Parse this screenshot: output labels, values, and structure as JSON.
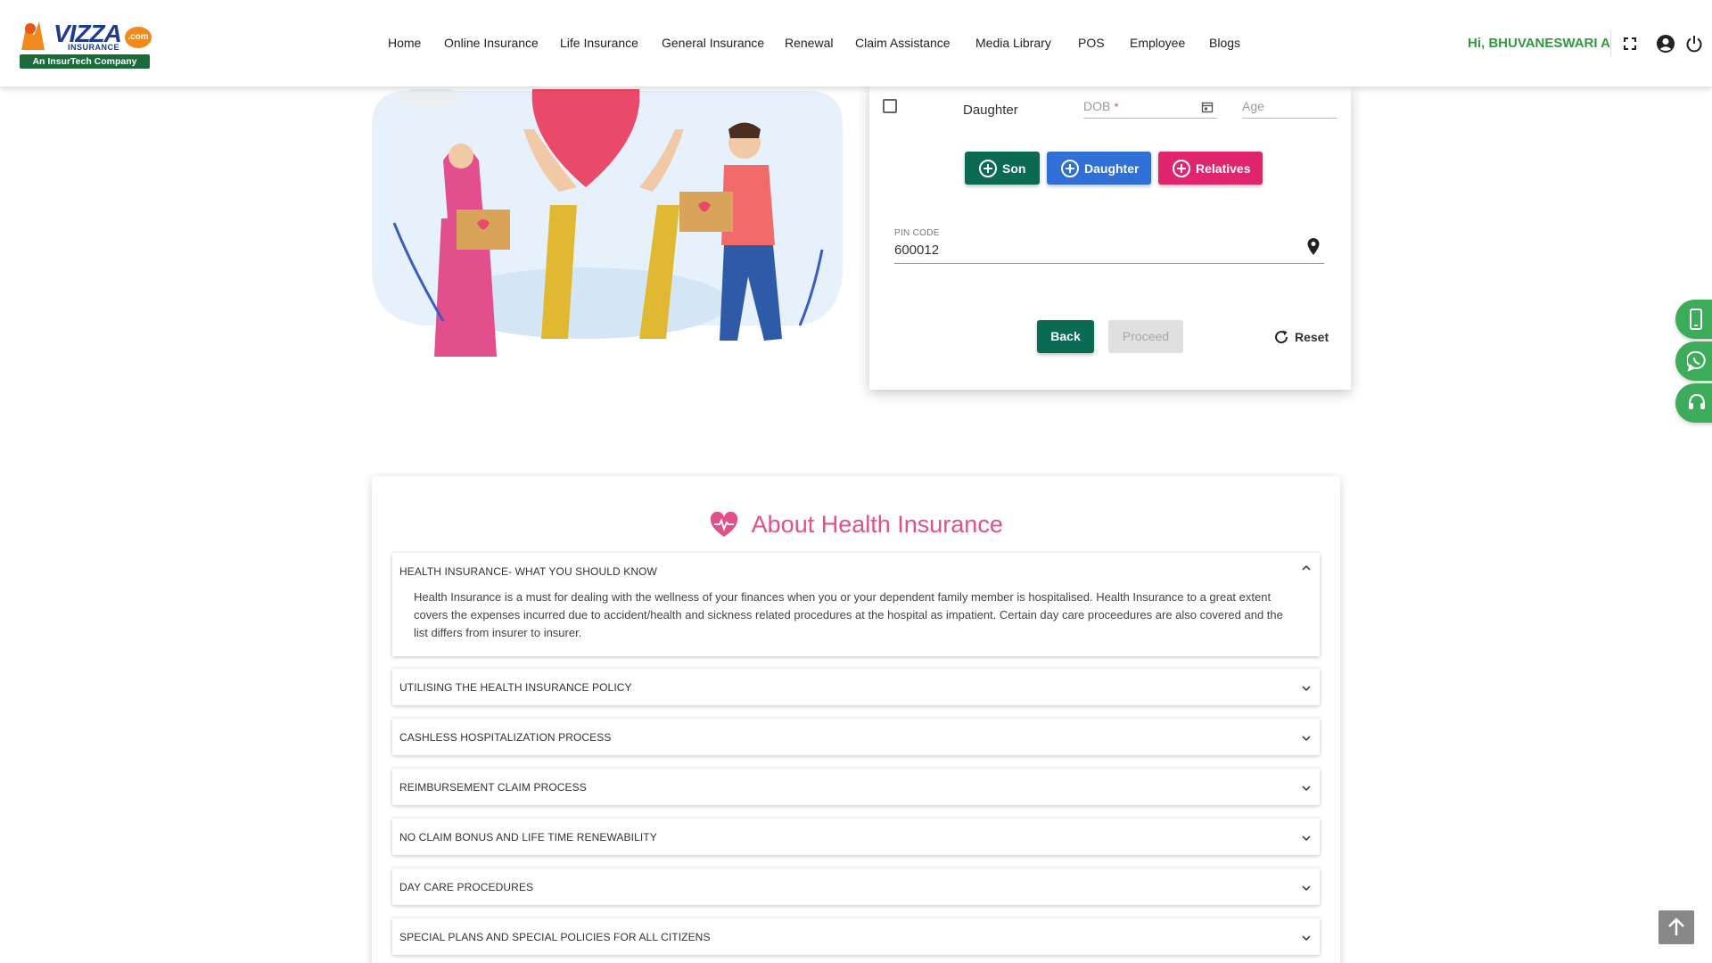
{
  "header": {
    "logo": {
      "brand": "VIZZA",
      "dotcom": ".com",
      "insurance": "INSURANCE",
      "tagline": "An InsurTech Company"
    },
    "nav": [
      {
        "label": "Home"
      },
      {
        "label": "Online Insurance"
      },
      {
        "label": "Life Insurance"
      },
      {
        "label": "General Insurance"
      },
      {
        "label": "Renewal"
      },
      {
        "label": "Claim Assistance"
      },
      {
        "label": "Media Library"
      },
      {
        "label": "POS"
      },
      {
        "label": "Employee"
      },
      {
        "label": "Blogs"
      }
    ],
    "greeting": "Hi, BHUVANESWARI A",
    "icons": [
      "fullscreen-icon",
      "account-icon",
      "power-icon"
    ]
  },
  "form": {
    "member_label": "Daughter",
    "dob_placeholder": "DOB",
    "dob_required": "*",
    "age_placeholder": "Age",
    "add_buttons": [
      {
        "label": "Son",
        "color": "#0b6b52"
      },
      {
        "label": "Daughter",
        "color": "#2f6fd6"
      },
      {
        "label": "Relatives",
        "color": "#e0246e"
      }
    ],
    "pin_label": "PIN CODE",
    "pin_value": "600012",
    "back_label": "Back",
    "proceed_label": "Proceed",
    "reset_label": "Reset"
  },
  "side_buttons": [
    "mobile-icon",
    "whatsapp-icon",
    "support-icon"
  ],
  "about": {
    "title": "About Health Insurance",
    "items": [
      {
        "heading": "HEALTH INSURANCE- WHAT YOU SHOULD KNOW",
        "expanded": true,
        "body": "Health Insurance is a must for dealing with the wellness of your finances when you or your dependent family member is hospitalised. Health Insurance to a great extent covers the expenses incurred due to accident/health and sickness related procedures at the hospital as impatient. Certain day care proceedures are also covered and the list differs from insurer to insurer."
      },
      {
        "heading": "UTILISING THE HEALTH INSURANCE POLICY",
        "expanded": false
      },
      {
        "heading": "CASHLESS HOSPITALIZATION PROCESS",
        "expanded": false
      },
      {
        "heading": "REIMBURSEMENT CLAIM PROCESS",
        "expanded": false
      },
      {
        "heading": "NO CLAIM BONUS AND LIFE TIME RENEWABILITY",
        "expanded": false
      },
      {
        "heading": "DAY CARE PROCEDURES",
        "expanded": false
      },
      {
        "heading": "SPECIAL PLANS AND SPECIAL POLICIES FOR ALL CITIZENS",
        "expanded": false
      }
    ]
  },
  "colors": {
    "accent_green": "#2f9a3c",
    "teal": "#0b6b52",
    "pink": "#e0508a"
  }
}
